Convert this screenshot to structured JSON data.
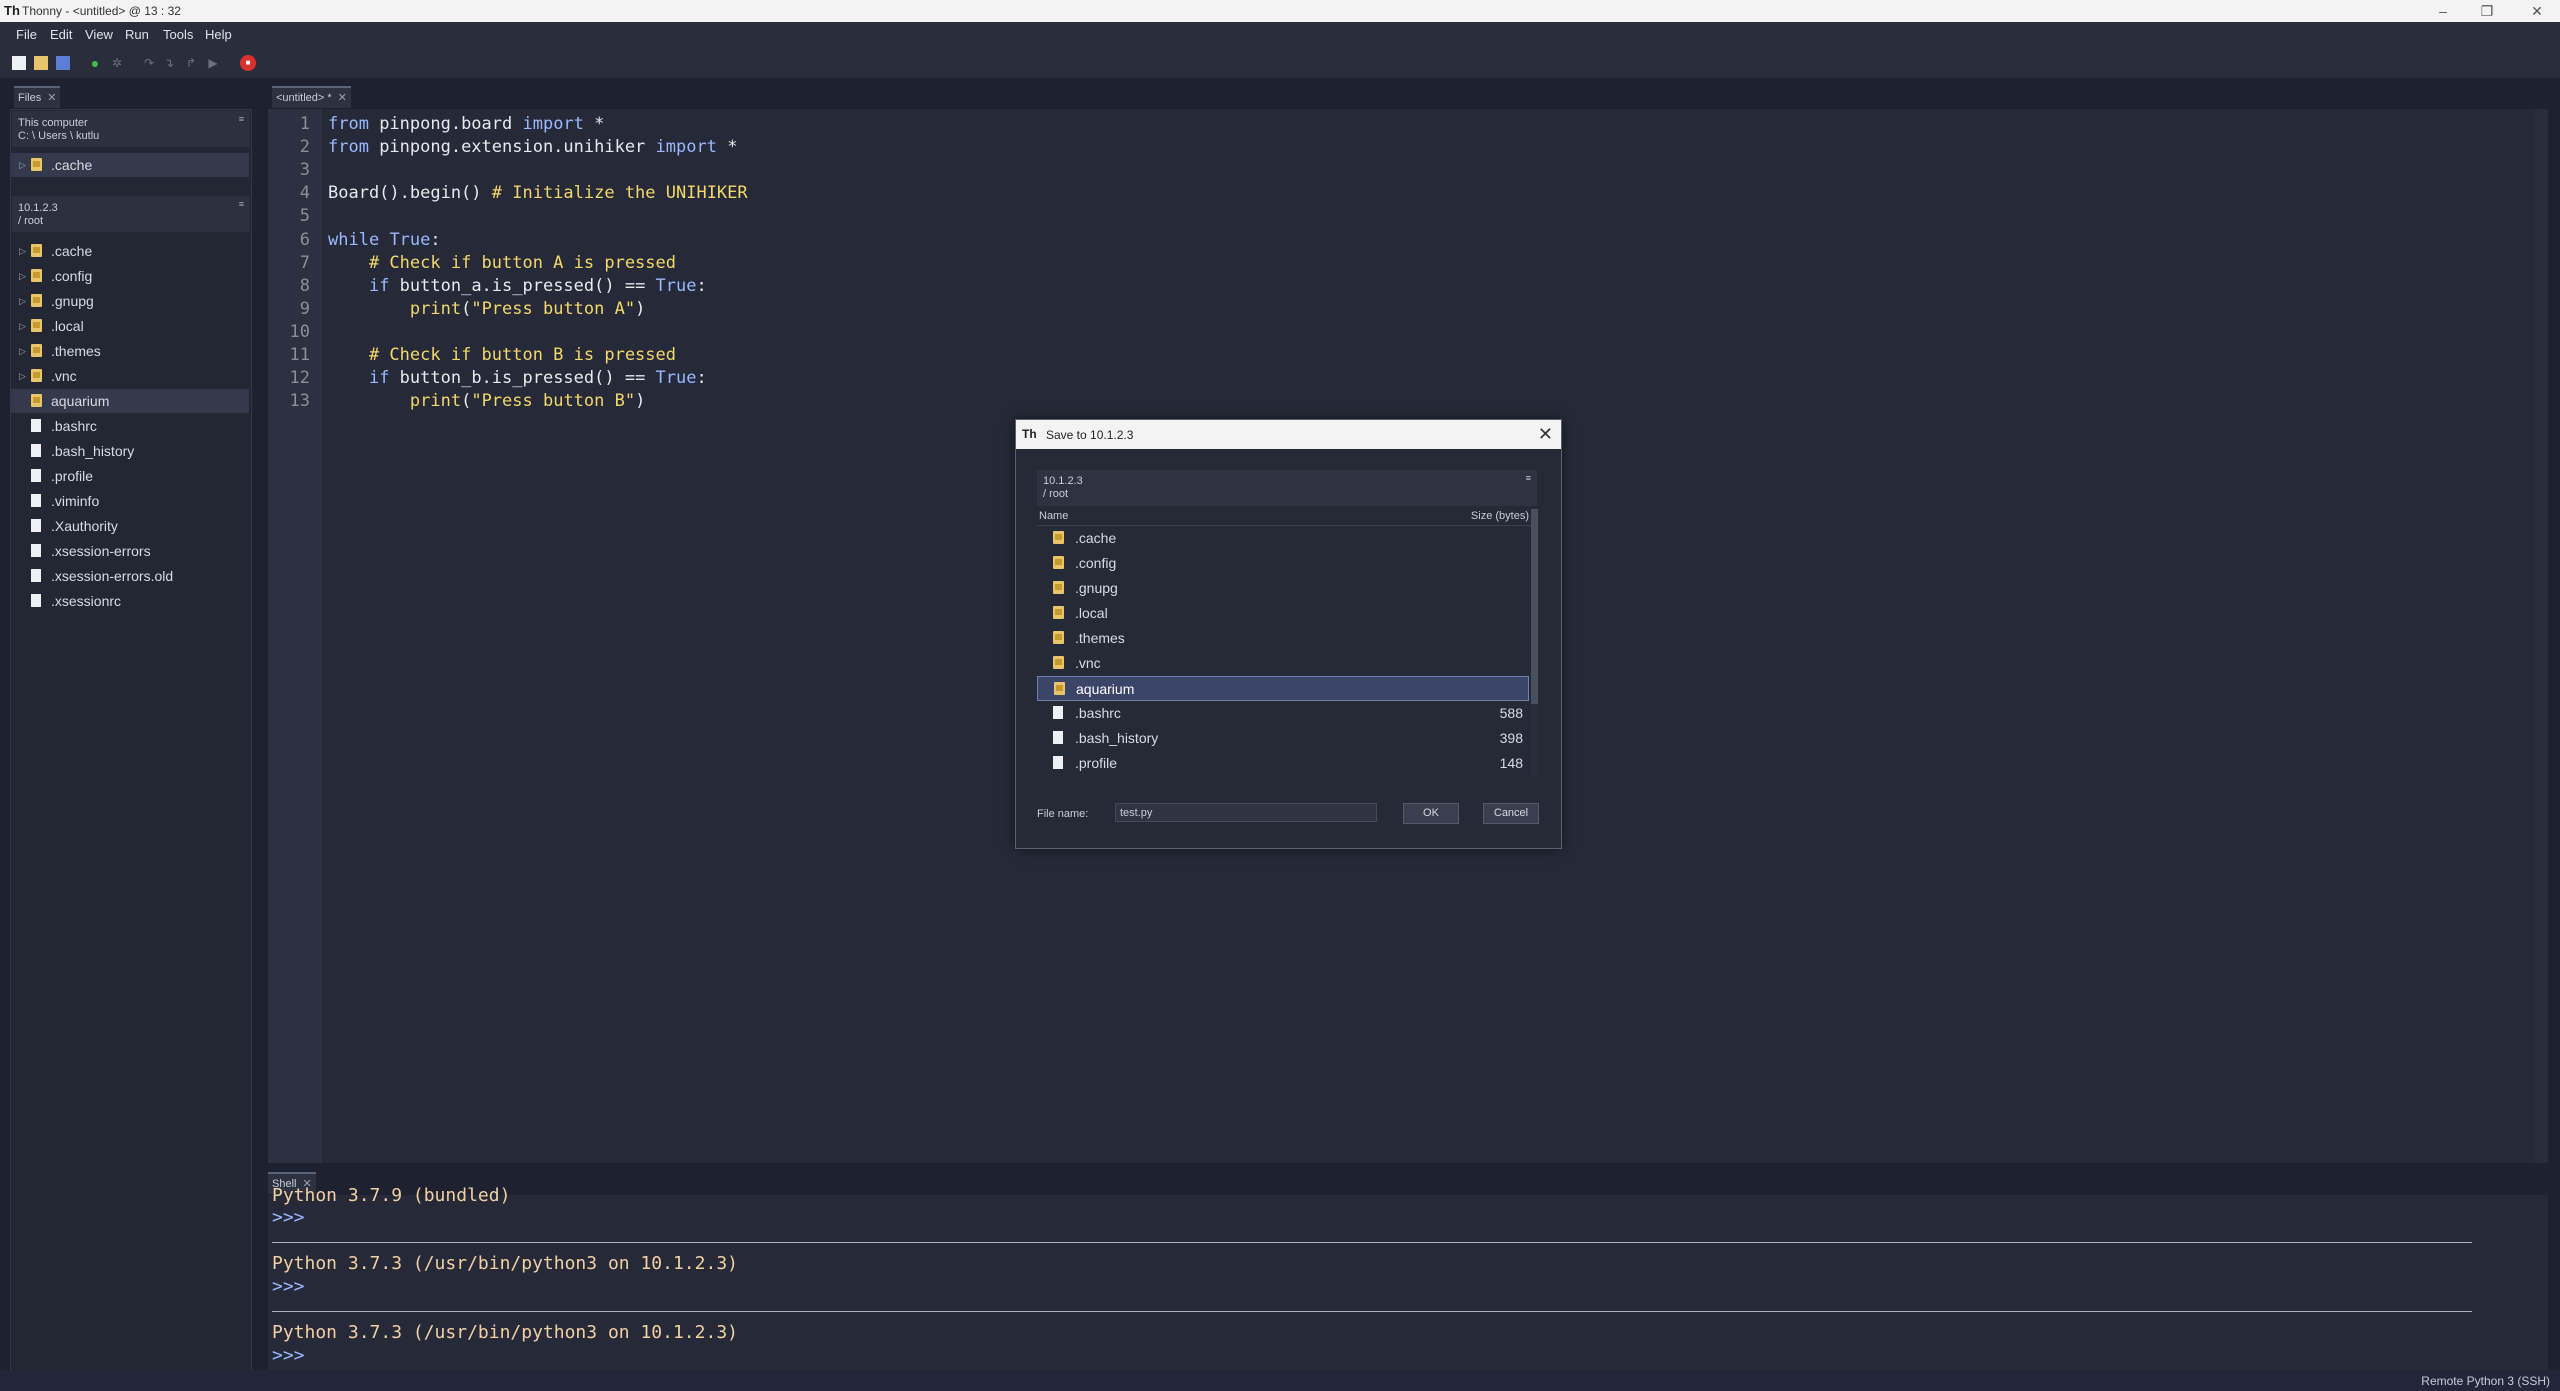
{
  "window": {
    "title": "Thonny  -  <untitled>  @  13 : 32"
  },
  "menu": [
    "File",
    "Edit",
    "View",
    "Run",
    "Tools",
    "Help"
  ],
  "files_tab": {
    "label": "Files"
  },
  "local": {
    "title": "This computer",
    "path": "C: \\ Users \\ kutlu",
    "items": [
      ".cache"
    ]
  },
  "remote": {
    "title": "10.1.2.3",
    "path": "/ root",
    "folders": [
      ".cache",
      ".config",
      ".gnupg",
      ".local",
      ".themes",
      ".vnc",
      "aquarium"
    ],
    "files": [
      ".bashrc",
      ".bash_history",
      ".profile",
      ".viminfo",
      ".Xauthority",
      ".xsession-errors",
      ".xsession-errors.old",
      ".xsessionrc"
    ]
  },
  "editor_tab": {
    "label": "<untitled> *"
  },
  "code_lines": [
    "from pinpong.board import *",
    "from pinpong.extension.unihiker import *",
    "",
    "Board().begin() # Initialize the UNIHIKER",
    "",
    "while True:",
    "    # Check if button A is pressed",
    "    if button_a.is_pressed() == True:",
    "        print(\"Press button A\")",
    "",
    "    # Check if button B is pressed",
    "    if button_b.is_pressed() == True:",
    "        print(\"Press button B\")"
  ],
  "shell": {
    "tab": "Shell",
    "top_cut": "Python 3.7.9 (bundled)",
    "prompt": ">>>",
    "line1": "Python 3.7.3 (/usr/bin/python3 on 10.1.2.3)",
    "line2": "Python 3.7.3 (/usr/bin/python3 on 10.1.2.3)"
  },
  "status": {
    "interpreter": "Remote Python 3 (SSH)"
  },
  "dialog": {
    "title": "Save to 10.1.2.3",
    "host": "10.1.2.3",
    "path": "/ root",
    "col_name": "Name",
    "col_size": "Size (bytes)",
    "rows": [
      {
        "name": ".cache",
        "size": "",
        "type": "folder"
      },
      {
        "name": ".config",
        "size": "",
        "type": "folder"
      },
      {
        "name": ".gnupg",
        "size": "",
        "type": "folder"
      },
      {
        "name": ".local",
        "size": "",
        "type": "folder"
      },
      {
        "name": ".themes",
        "size": "",
        "type": "folder"
      },
      {
        "name": ".vnc",
        "size": "",
        "type": "folder"
      },
      {
        "name": "aquarium",
        "size": "",
        "type": "folder"
      },
      {
        "name": ".bashrc",
        "size": "588",
        "type": "file"
      },
      {
        "name": ".bash_history",
        "size": "398",
        "type": "file"
      },
      {
        "name": ".profile",
        "size": "148",
        "type": "file"
      }
    ],
    "selected": "aquarium",
    "filename_label": "File name:",
    "filename_value": "test.py",
    "ok": "OK",
    "cancel": "Cancel"
  }
}
